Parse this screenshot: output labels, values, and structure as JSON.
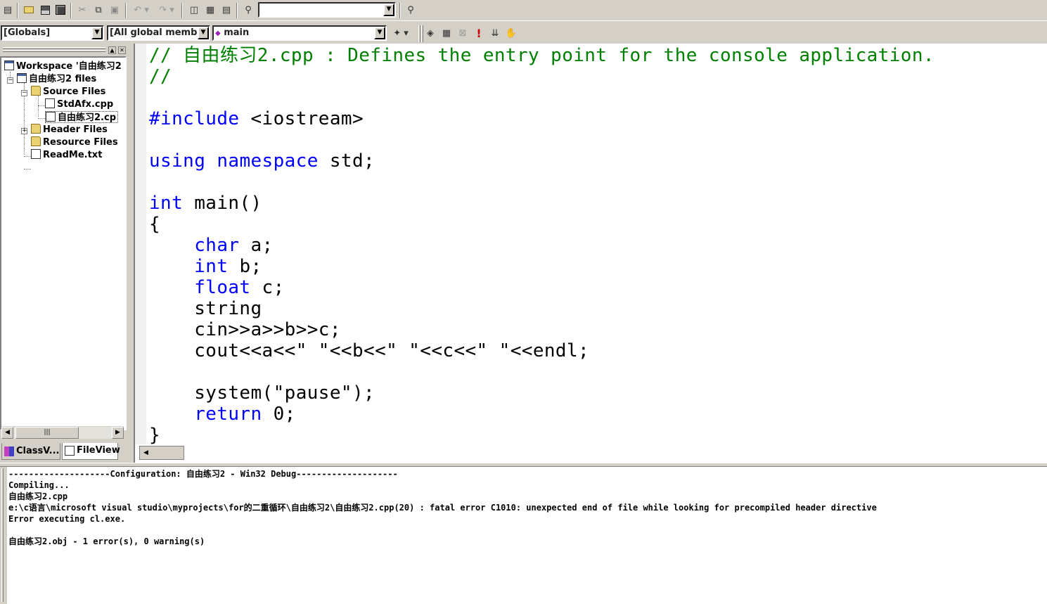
{
  "toolbar1": {
    "find_combo_value": "",
    "icons": [
      "new-text-file-icon",
      "open-folder-icon",
      "save-icon",
      "save-all-icon",
      "cut-icon",
      "copy-icon",
      "paste-icon",
      "undo-icon",
      "redo-icon",
      "workspace-icon",
      "output-icon",
      "window-list-icon",
      "find-in-files-icon",
      "find-icon"
    ]
  },
  "toolbar2": {
    "scope_combo": "[Globals]",
    "members_combo": "[All global member",
    "function_combo": "main",
    "icons": [
      "wizard-action-icon",
      "compile-icon",
      "build-icon",
      "stop-build-icon",
      "execute-icon",
      "go-icon",
      "breakpoint-icon"
    ]
  },
  "workspace": {
    "tree": [
      {
        "label": "Workspace '自由练习2",
        "level": 0
      },
      {
        "label": "自由练习2 files",
        "level": 1
      },
      {
        "label": "Source Files",
        "level": 2
      },
      {
        "label": "StdAfx.cpp",
        "level": 3
      },
      {
        "label": "自由练习2.cp",
        "level": 3
      },
      {
        "label": "Header Files",
        "level": 2
      },
      {
        "label": "Resource Files",
        "level": 2
      },
      {
        "label": "ReadMe.txt",
        "level": 2
      }
    ],
    "tabs": [
      {
        "label": "ClassV..."
      },
      {
        "label": "FileView"
      }
    ]
  },
  "editor": {
    "lines": [
      "// 自由练习2.cpp : Defines the entry point for the console application.",
      "//",
      "",
      "#include <iostream>",
      "",
      "using namespace std;",
      "",
      "int main()",
      "{",
      "    char a;",
      "    int b;",
      "    float c;",
      "    string",
      "    cin>>a>>b>>c;",
      "    cout<<a<<\" \"<<b<<\" \"<<c<<\" \"<<endl;",
      "",
      "    system(\"pause\");",
      "    return 0;",
      "}"
    ],
    "keyword_color": "#0000ff",
    "comment_color": "#008000"
  },
  "output": {
    "lines": [
      "--------------------Configuration: 自由练习2 - Win32 Debug--------------------",
      "Compiling...",
      "自由练习2.cpp",
      "e:\\c语言\\microsoft visual studio\\myprojects\\for的二重循环\\自由练习2\\自由练习2.cpp(20) : fatal error C1010: unexpected end of file while looking for precompiled header directive",
      "Error executing cl.exe.",
      "",
      "自由练习2.obj - 1 error(s), 0 warning(s)"
    ]
  }
}
